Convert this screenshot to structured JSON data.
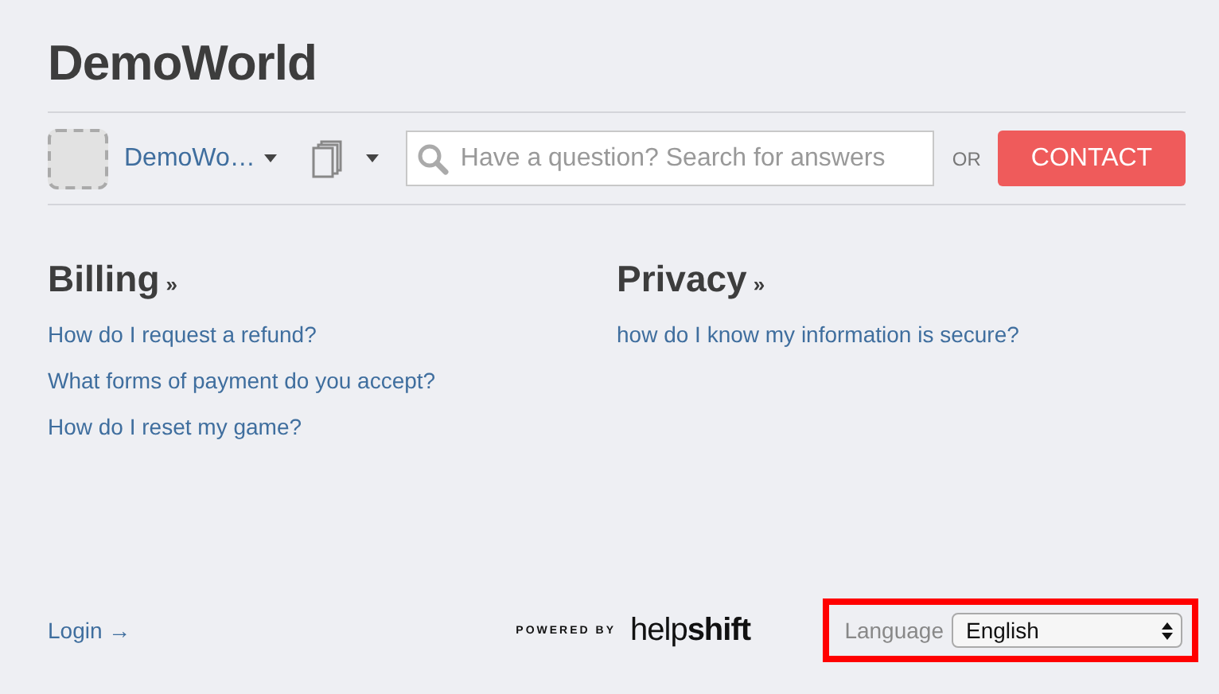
{
  "header": {
    "title": "DemoWorld"
  },
  "toolbar": {
    "app_name": "DemoWo…",
    "search": {
      "placeholder": "Have a question? Search for answers"
    },
    "or_label": "OR",
    "contact_button": "CONTACT"
  },
  "sections": [
    {
      "title": "Billing",
      "marker": "»",
      "links": [
        "How do I request a refund?",
        "What forms of payment do you accept?",
        "How do I reset my game?"
      ]
    },
    {
      "title": "Privacy",
      "marker": "»",
      "links": [
        "how do I know my information is secure?"
      ]
    }
  ],
  "footer": {
    "login": "Login →",
    "powered_by": "POWERED BY",
    "brand": "help**shift**",
    "language_label": "Language",
    "language_value": "English",
    "highlighted": true
  }
}
